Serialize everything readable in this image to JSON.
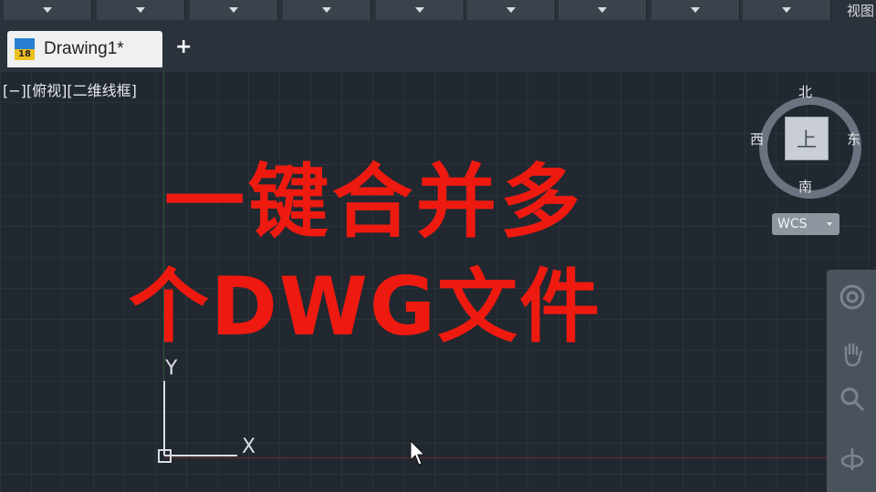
{
  "ribbon": {
    "dropdown_count": 9,
    "right_label": "视图"
  },
  "tabs": {
    "active_title": "Drawing1*",
    "app_icon_text": "18",
    "add_label": "+"
  },
  "viewport": {
    "label": "[−][俯视][二维线框]"
  },
  "overlay": {
    "line1": "一键合并多",
    "line2": "个DWG文件",
    "color": "#ee1a10"
  },
  "ucs": {
    "y_label": "Y",
    "x_label": "X"
  },
  "viewcube": {
    "north": "北",
    "south": "南",
    "east": "东",
    "west": "西",
    "face": "上",
    "wcs_label": "WCS"
  },
  "navbar": {
    "icons": [
      "steering-wheel-icon",
      "pan-hand-icon",
      "zoom-icon",
      "orbit-icon"
    ]
  }
}
